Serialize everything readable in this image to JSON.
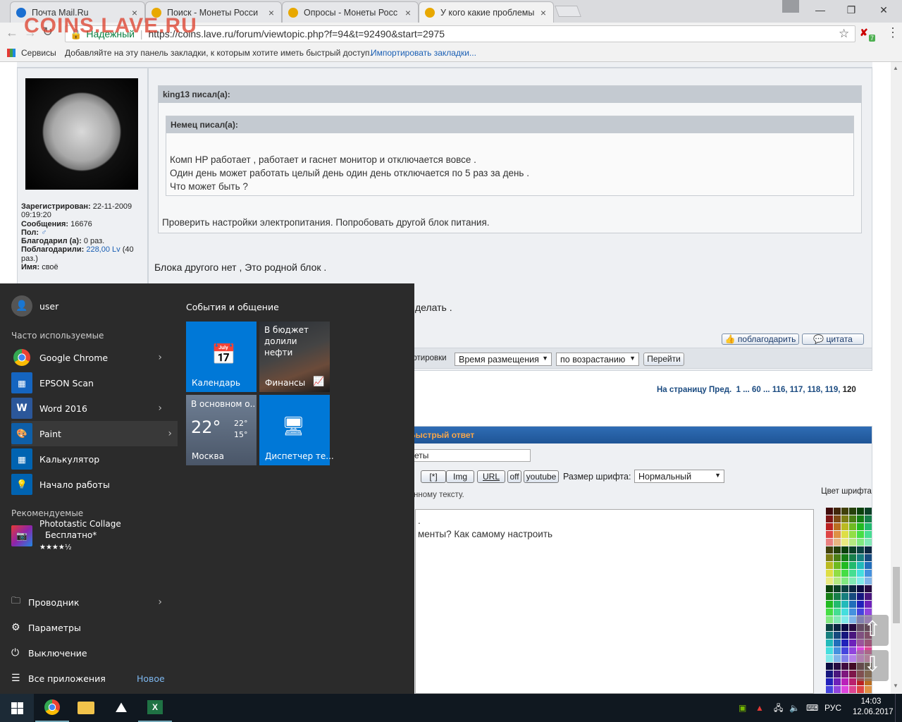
{
  "browser": {
    "tabs": [
      {
        "title": "Почта Mail.Ru",
        "color": "#1b6fd1"
      },
      {
        "title": "Поиск - Монеты Росси",
        "color": "#e8a800"
      },
      {
        "title": "Опросы - Монеты Росс",
        "color": "#e8a800"
      },
      {
        "title": "У кого какие проблемы",
        "color": "#e8a800"
      }
    ],
    "close_glyph": "×",
    "url_secure_label": "Надежный",
    "url": "https://coins.lave.ru/forum/viewtopic.php?f=94&t=92490&start=2975",
    "bookmarks_apps": "Сервисы",
    "bookmarks_hint": "Добавляйте на эту панель закладки, к которым хотите иметь быстрый доступ.",
    "bookmarks_import": "Импортировать закладки...",
    "ext_badge": "7"
  },
  "watermark": "COINS.LAVE.RU",
  "post": {
    "profile": {
      "registered_label": "Зарегистрирован:",
      "registered_value": "22-11-2009 09:19:20",
      "messages_label": "Сообщения:",
      "messages_value": "16676",
      "gender_label": "Пол:",
      "thanked_label": "Благодарил (а):",
      "thanked_value": "0 раз.",
      "got_thanks_label": "Поблагодарили:",
      "got_thanks_value": "228,00 Lv",
      "got_thanks_count": "(40 раз.)",
      "name_label": "Имя:",
      "name_value": "своё"
    },
    "outer_quote_author": "king13 писал(а):",
    "inner_quote_author": "Немец писал(а):",
    "inner_lines": [
      "Комп HP работает , работает и гаснет монитор и отключается вовсе .",
      "Один день может работать целый день один день отключается по 5 раз за день .",
      "Что может быть ?"
    ],
    "outer_reply": "Проверить настройки электропитания. Попробовать другой блок питания.",
    "body_line1": "Блока другого нет , Это родной блок .",
    "body_line2_tail": "делать .",
    "thank_btn": "поблагодарить",
    "quote_btn": "цитата"
  },
  "sort": {
    "label_tail": "ортировки",
    "field": "Время размещения",
    "order": "по возрастанию",
    "go": "Перейти"
  },
  "pagination": {
    "label": "На страницу",
    "prev": "Пред.",
    "pages": [
      "1",
      "...",
      "60",
      "...",
      "116,",
      "117,",
      "118,",
      "119,"
    ],
    "current": "120"
  },
  "quick_reply": {
    "title": "Быстрый ответ",
    "subject_value": "еты",
    "buttons": [
      "[*]",
      "Img",
      "URL",
      "off",
      "youtube"
    ],
    "font_size_label": "Размер шрифта:",
    "font_size_value": "Нормальный",
    "hint_tail": "нному тексту.",
    "text_line1": ".",
    "text_line2": "менты? Как самому настроить",
    "color_label": "Цвет шрифта"
  },
  "start_menu": {
    "user": "user",
    "frequent_label": "Часто используемые",
    "apps": [
      {
        "name": "Google Chrome",
        "arrow": true,
        "color": "#2b2b2b"
      },
      {
        "name": "EPSON Scan",
        "arrow": false,
        "color": "#1565c0"
      },
      {
        "name": "Word 2016",
        "arrow": true,
        "color": "#2b579a"
      },
      {
        "name": "Paint",
        "arrow": true,
        "color": "#0e5fa8"
      },
      {
        "name": "Калькулятор",
        "arrow": false,
        "color": "#0063b1"
      },
      {
        "name": "Начало работы",
        "arrow": false,
        "color": "#0063b1"
      }
    ],
    "recommended_label": "Рекомендуемые",
    "rec_app": "Phototastic Collage",
    "rec_price": "Бесплатно*",
    "rec_stars": "★★★★½",
    "bottom": [
      {
        "name": "Проводник"
      },
      {
        "name": "Параметры"
      },
      {
        "name": "Выключение"
      },
      {
        "name": "Все приложения"
      }
    ],
    "new_badge": "Новое",
    "tiles_header": "События и общение",
    "tile_calendar": "Календарь",
    "tile_finance_news": "В бюджет долили нефти",
    "tile_finance": "Финансы",
    "tile_weather_head": "В основном о...",
    "tile_weather_temp": "22°",
    "tile_weather_hi": "22°",
    "tile_weather_lo": "15°",
    "tile_weather_city": "Москва",
    "tile_devmgr": "Диспетчер те..."
  },
  "taskbar": {
    "lang": "РУС",
    "time": "14:03",
    "date": "12.06.2017"
  }
}
